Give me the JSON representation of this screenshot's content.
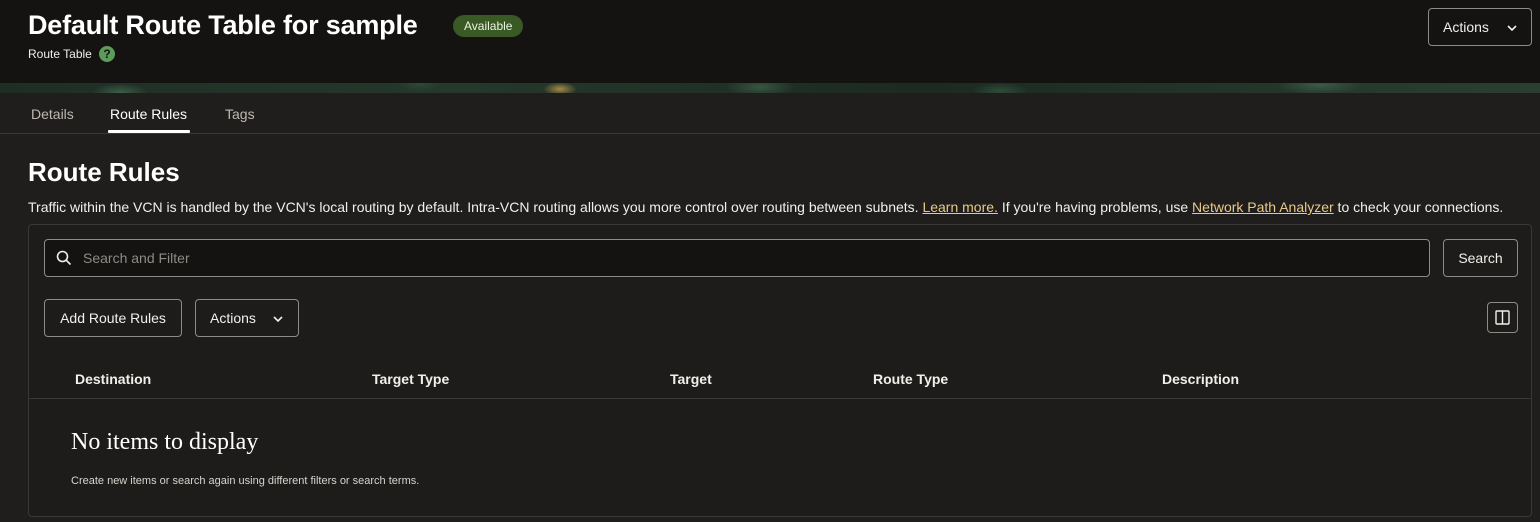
{
  "header": {
    "title": "Default Route Table for sample",
    "status": "Available",
    "subtitle": "Route Table",
    "help_icon": "question-circle-icon",
    "actions_label": "Actions"
  },
  "tabs": [
    {
      "label": "Details",
      "active": false
    },
    {
      "label": "Route Rules",
      "active": true
    },
    {
      "label": "Tags",
      "active": false
    }
  ],
  "section": {
    "title": "Route Rules",
    "desc_part1": "Traffic within the VCN is handled by the VCN's local routing by default. Intra-VCN routing allows you more control over routing between subnets. ",
    "learn_more": "Learn more.",
    "desc_part2": " If you're having problems, use ",
    "analyzer_link": "Network Path Analyzer",
    "desc_part3": " to check your connections."
  },
  "search": {
    "placeholder": "Search and Filter",
    "button": "Search"
  },
  "toolbar": {
    "add_label": "Add Route Rules",
    "actions_label": "Actions"
  },
  "table": {
    "columns": [
      "Destination",
      "Target Type",
      "Target",
      "Route Type",
      "Description"
    ],
    "empty_title": "No items to display",
    "empty_desc": "Create new items or search again using different filters or search terms."
  },
  "colors": {
    "background": "#201e1c",
    "header": "#141312",
    "status_badge": "#3a5a25",
    "link": "#e8c98a",
    "help": "#5d9b5b"
  }
}
